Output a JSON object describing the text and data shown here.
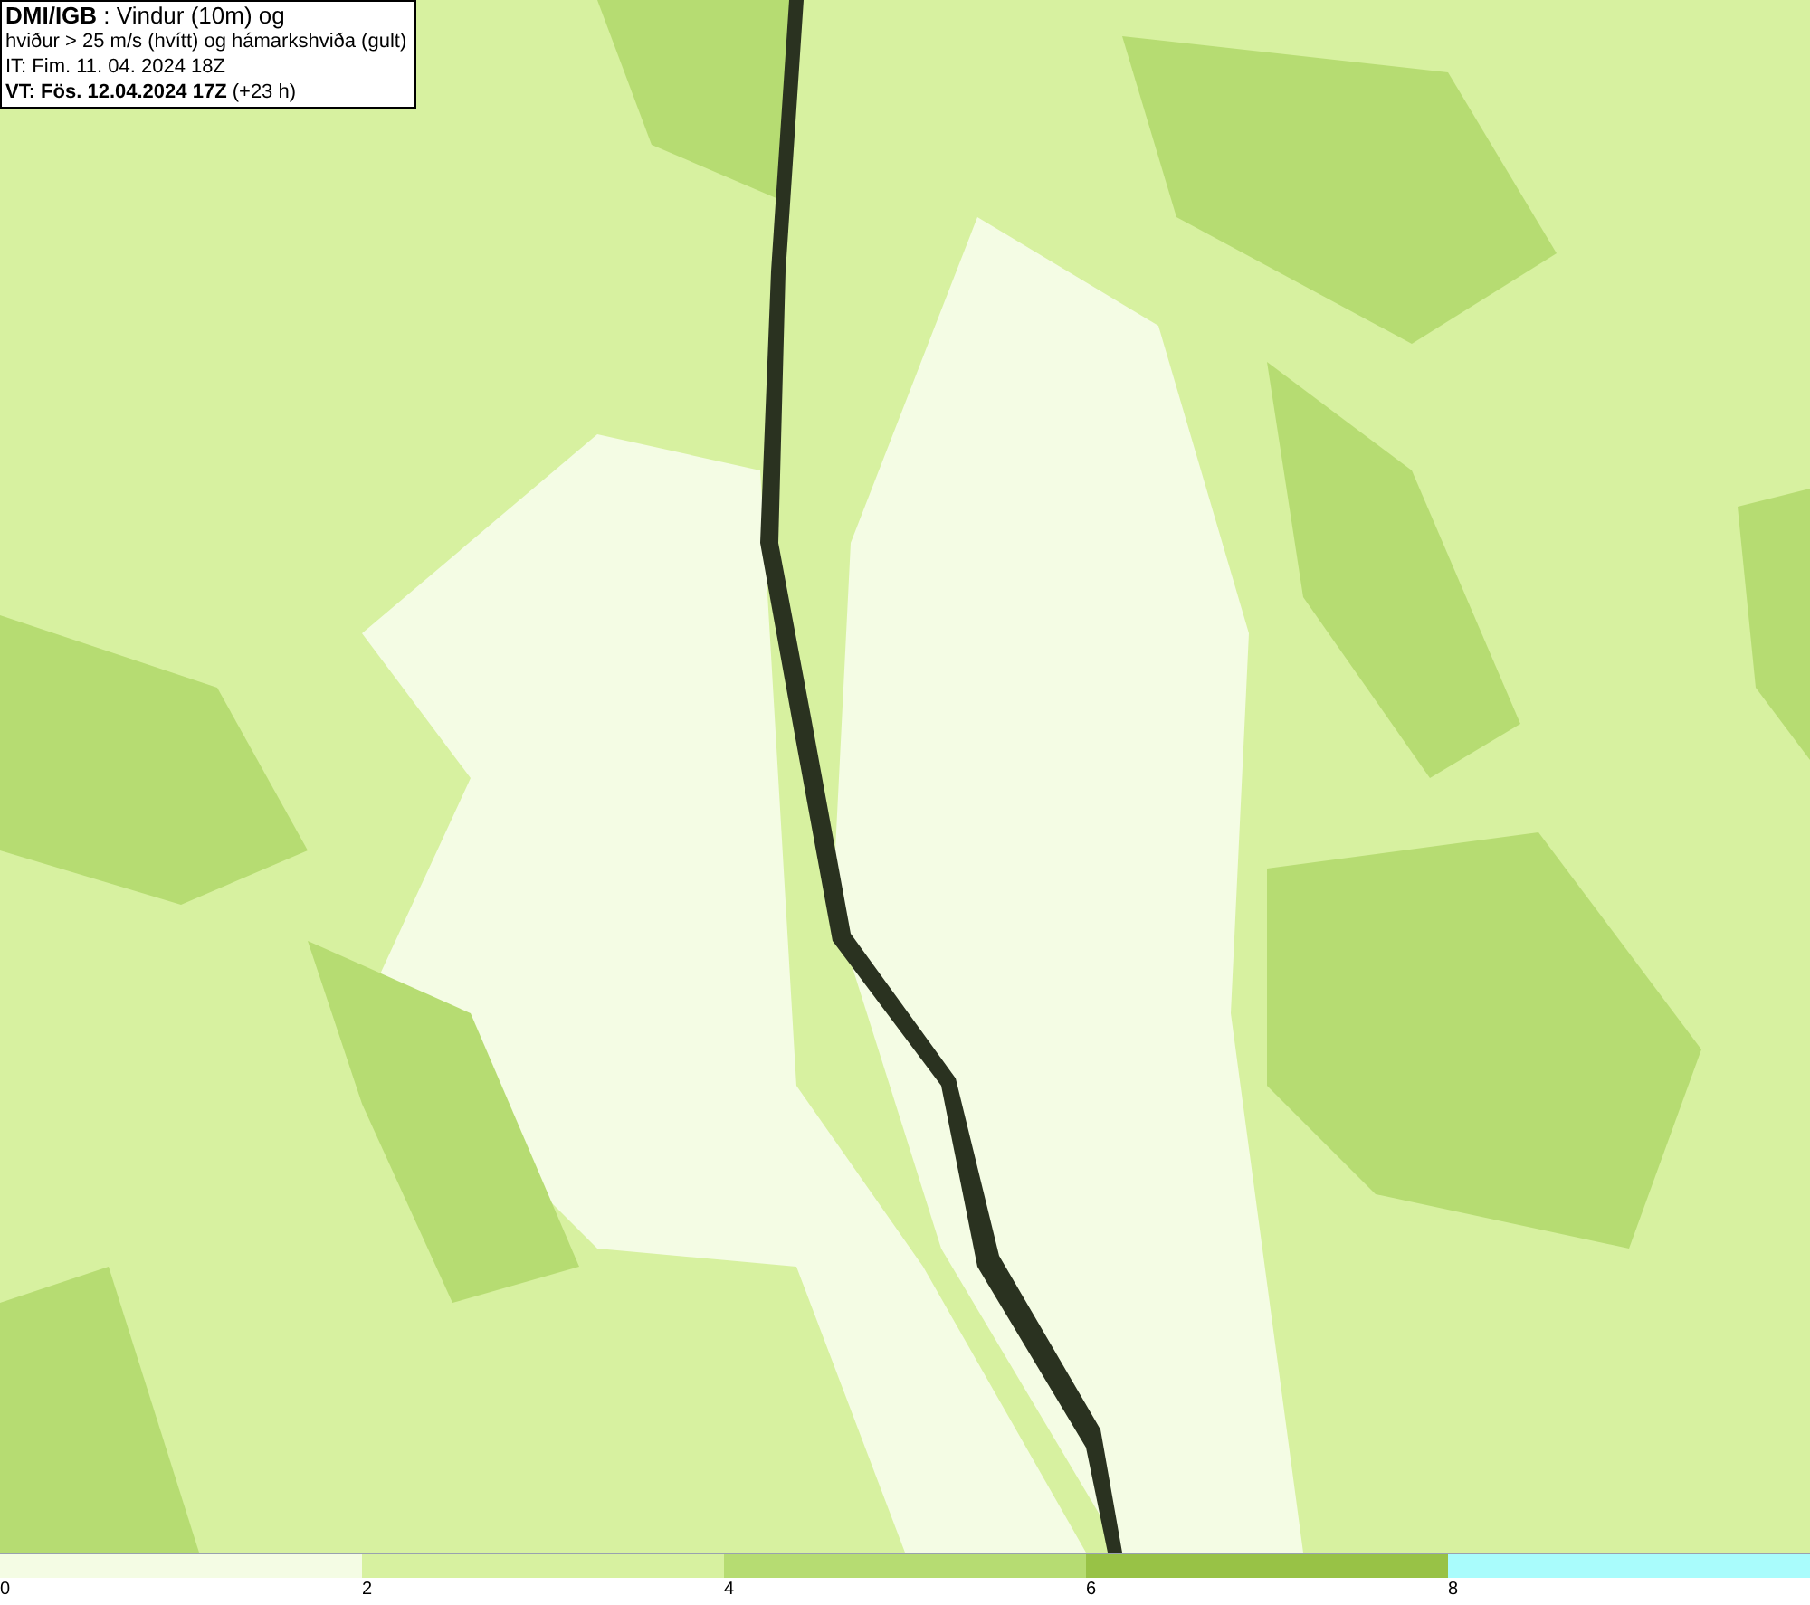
{
  "title_box": {
    "lines": [
      "**DMI/IGB** : Vindur (10m) og",
      "hviður > 25 m/s (hvítt) og hámarkshviða (gult)",
      "IT: Fim. 11. 04. 2024 18Z",
      "**VT: Fös. 12.04.2024 17Z** (+23 h)"
    ]
  },
  "legend": {
    "segments": [
      {
        "color": "#f4fce4"
      },
      {
        "color": "#d7f1a0"
      },
      {
        "color": "#b6dc72"
      },
      {
        "color": "#98c246"
      },
      {
        "color": "#a9fcfc"
      }
    ],
    "ticks": [
      "0",
      "2",
      "4",
      "6",
      "8"
    ]
  }
}
